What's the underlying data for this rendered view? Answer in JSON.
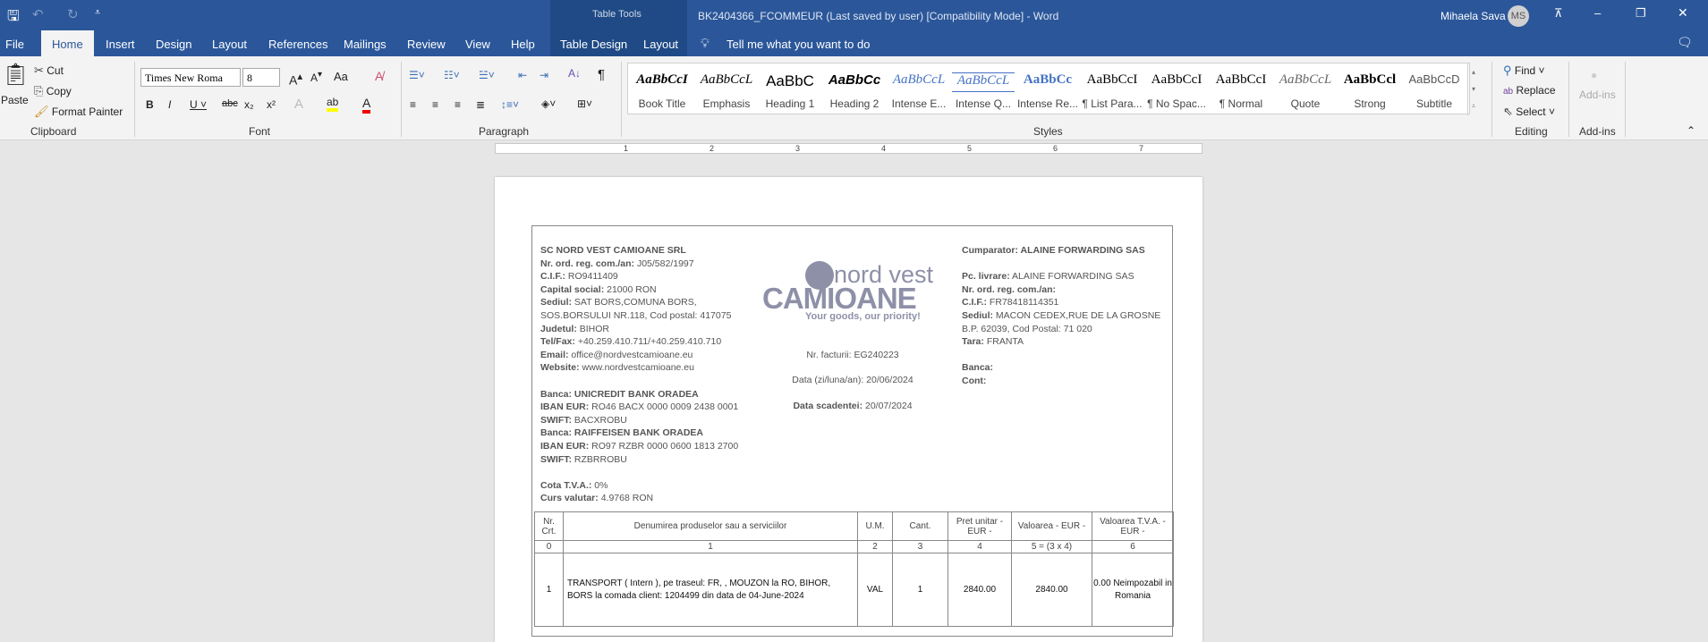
{
  "titlebar": {
    "title": "BK2404366_FCOMMEUR (Last saved by user) [Compatibility Mode]  -  Word",
    "context_group": "Table Tools",
    "user": "Mihaela Sava",
    "initials": "MS"
  },
  "tabs": [
    "File",
    "Home",
    "Insert",
    "Design",
    "Layout",
    "References",
    "Mailings",
    "Review",
    "View",
    "Help",
    "Table Design",
    "Layout"
  ],
  "tell_me": "Tell me what you want to do",
  "clipboard": {
    "paste": "Paste",
    "cut": "Cut",
    "copy": "Copy",
    "format_painter": "Format Painter",
    "label": "Clipboard"
  },
  "font": {
    "name": "Times New Roma",
    "size": "8",
    "label": "Font",
    "aa": "Aa"
  },
  "paragraph": {
    "label": "Paragraph"
  },
  "styles": {
    "label": "Styles",
    "items": [
      {
        "sample": "AaBbCcI",
        "name": "Book Title"
      },
      {
        "sample": "AaBbCcL",
        "name": "Emphasis"
      },
      {
        "sample": "AaBbC",
        "name": "Heading 1"
      },
      {
        "sample": "AaBbCc",
        "name": "Heading 2"
      },
      {
        "sample": "AaBbCcL",
        "name": "Intense E..."
      },
      {
        "sample": "AaBbCcL",
        "name": "Intense Q..."
      },
      {
        "sample": "AaBbCc",
        "name": "Intense Re..."
      },
      {
        "sample": "AaBbCcI",
        "name": "¶ List Para..."
      },
      {
        "sample": "AaBbCcI",
        "name": "¶ No Spac..."
      },
      {
        "sample": "AaBbCcI",
        "name": "¶ Normal"
      },
      {
        "sample": "AaBbCcL",
        "name": "Quote"
      },
      {
        "sample": "AaBbCcl",
        "name": "Strong"
      },
      {
        "sample": "AaBbCcD",
        "name": "Subtitle"
      }
    ]
  },
  "editing": {
    "find": "Find",
    "replace": "Replace",
    "select": "Select",
    "label": "Editing"
  },
  "addins": {
    "button": "Add-ins",
    "label": "Add-ins"
  },
  "ruler": [
    "1",
    "2",
    "3",
    "4",
    "5",
    "6",
    "7"
  ],
  "seller": {
    "name": "SC NORD VEST CAMIOANE SRL",
    "lines": [
      {
        "k": "Nr. ord. reg. com./an:",
        "v": " J05/582/1997"
      },
      {
        "k": "C.I.F.:",
        "v": " RO9411409"
      },
      {
        "k": "Capital social:",
        "v": " 21000 RON"
      },
      {
        "k": "Sediul:",
        "v": " SAT BORS,COMUNA BORS,"
      },
      {
        "k": "",
        "v": "SOS.BORSULUI NR.118, Cod postal: 417075"
      },
      {
        "k": "Judetul:",
        "v": " BIHOR"
      },
      {
        "k": "Tel/Fax:",
        "v": " +40.259.410.711/+40.259.410.710"
      },
      {
        "k": "Email:",
        "v": " office@nordvestcamioane.eu"
      },
      {
        "k": "Website:",
        "v": " www.nordvestcamioane.eu"
      },
      {
        "k": "",
        "v": ""
      },
      {
        "k": "Banca: UNICREDIT BANK ORADEA",
        "v": ""
      },
      {
        "k": "IBAN EUR:",
        "v": " RO46 BACX 0000 0009 2438 0001"
      },
      {
        "k": "SWIFT:",
        "v": " BACXROBU"
      },
      {
        "k": "Banca: RAIFFEISEN BANK ORADEA",
        "v": ""
      },
      {
        "k": "IBAN EUR:",
        "v": " RO97 RZBR 0000 0600 1813 2700"
      },
      {
        "k": "SWIFT:",
        "v": " RZBRROBU"
      },
      {
        "k": "",
        "v": ""
      },
      {
        "k": "Cota T.V.A.:",
        "v": " 0%"
      },
      {
        "k": "Curs valutar:",
        "v": " 4.9768 RON"
      }
    ]
  },
  "logo": {
    "top": "nord vest",
    "main": "CAMIOANE",
    "tagline": "Your goods, our priority!"
  },
  "invoice": {
    "nr": "Nr. facturii: EG240223",
    "date": "Data (zi/luna/an): 20/06/2024",
    "due_label": "Data scadentei:",
    "due": " 20/07/2024"
  },
  "buyer": {
    "title": "Cumparator: ALAINE FORWARDING SAS",
    "lines": [
      {
        "k": "Pc. livrare:",
        "v": " ALAINE FORWARDING SAS"
      },
      {
        "k": "Nr. ord. reg. com./an:",
        "v": ""
      },
      {
        "k": "C.I.F.:",
        "v": " FR78418114351"
      },
      {
        "k": "Sediul:",
        "v": " MACON CEDEX,RUE DE LA GROSNE"
      },
      {
        "k": "",
        "v": "B.P. 62039, Cod Postal: 71 020"
      },
      {
        "k": "Tara:",
        "v": " FRANTA"
      },
      {
        "k": "",
        "v": ""
      },
      {
        "k": "Banca:",
        "v": ""
      },
      {
        "k": "Cont:",
        "v": ""
      }
    ]
  },
  "table": {
    "headers": [
      "Nr. Crt.",
      "Denumirea produselor sau a serviciilor",
      "U.M.",
      "Cant.",
      "Pret unitar - EUR -",
      "Valoarea - EUR -",
      "Valoarea T.V.A. - EUR -"
    ],
    "index": [
      "0",
      "1",
      "2",
      "3",
      "4",
      "5 = (3 x 4)",
      "6"
    ],
    "rows": [
      [
        "1",
        "TRANSPORT ( Intern ), pe traseul: FR, , MOUZON la RO, BIHOR, BORS la comada client: 1204499 din data de 04-June-2024",
        "VAL",
        "1",
        "2840.00",
        "2840.00",
        "0.00 Neimpozabil in Romania"
      ]
    ]
  },
  "colors": {
    "titlebar": "#2b579a",
    "context": "#1f4a86",
    "logo": "#8e90a8"
  }
}
